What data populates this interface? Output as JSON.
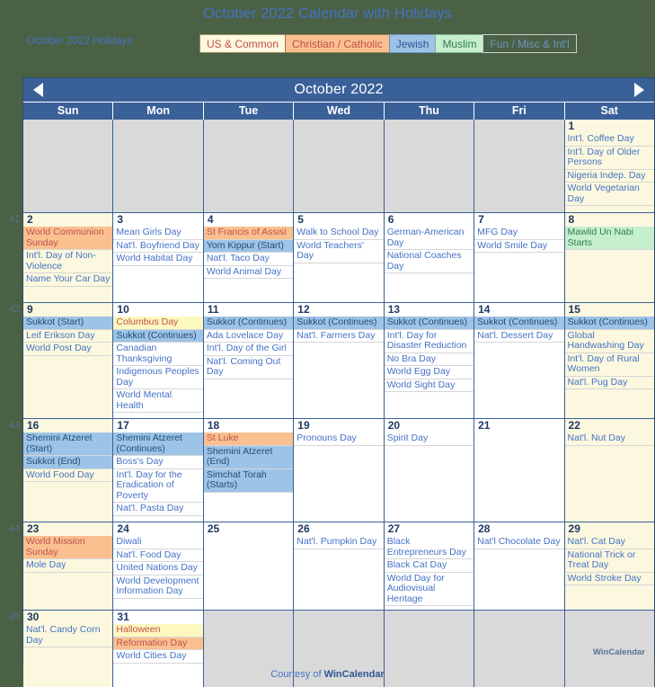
{
  "page": {
    "title": "October 2022 Calendar with Holidays",
    "legend_label": "October 2022 Holidays:",
    "footer_prefix": "Courtesy of ",
    "footer_brand": "WinCalendar",
    "watermark": "WinCalendar",
    "background_color": "#4a6145",
    "accent_color": "#4472c4"
  },
  "legend": [
    {
      "label": "US & Common",
      "key": "us",
      "bg": "#fdf8e0",
      "fg": "#c0504d"
    },
    {
      "label": "Christian / Catholic",
      "key": "chr",
      "bg": "#fac090",
      "fg": "#c0504d"
    },
    {
      "label": "Jewish",
      "key": "jew",
      "bg": "#9dc3e6",
      "fg": "#2f5597"
    },
    {
      "label": "Muslim",
      "key": "mus",
      "bg": "#c6efce",
      "fg": "#2f7d4f"
    },
    {
      "label": "Fun / Misc & Int'l",
      "key": "fun",
      "bg": "#4a6145",
      "fg": "#6f94c6"
    }
  ],
  "calendar": {
    "month_title": "October 2022",
    "prev_label": "◀",
    "next_label": "▶",
    "day_names": [
      "Sun",
      "Mon",
      "Tue",
      "Wed",
      "Thu",
      "Fri",
      "Sat"
    ],
    "weeks": [
      {
        "week_number": "",
        "days": [
          {
            "num": "",
            "blank": true,
            "events": []
          },
          {
            "num": "",
            "blank": true,
            "events": []
          },
          {
            "num": "",
            "blank": true,
            "events": []
          },
          {
            "num": "",
            "blank": true,
            "events": []
          },
          {
            "num": "",
            "blank": true,
            "events": []
          },
          {
            "num": "",
            "blank": true,
            "events": []
          },
          {
            "num": "1",
            "tint": true,
            "events": [
              {
                "text": "Int'l. Coffee Day",
                "type": "us"
              },
              {
                "text": "Int'l. Day of Older Persons",
                "type": "us"
              },
              {
                "text": "Nigeria Indep. Day",
                "type": "us"
              },
              {
                "text": "World Vegetarian Day",
                "type": "us"
              }
            ]
          }
        ]
      },
      {
        "week_number": "41",
        "days": [
          {
            "num": "2",
            "tint": true,
            "events": [
              {
                "text": "World Communion Sunday",
                "type": "chr"
              },
              {
                "text": "Int'l. Day of Non-Violence",
                "type": "us"
              },
              {
                "text": "Name Your Car Day",
                "type": "us"
              }
            ]
          },
          {
            "num": "3",
            "events": [
              {
                "text": "Mean Girls Day",
                "type": "us"
              },
              {
                "text": "Nat'l. Boyfriend Day",
                "type": "us"
              },
              {
                "text": "World Habitat Day",
                "type": "us"
              }
            ]
          },
          {
            "num": "4",
            "events": [
              {
                "text": "St Francis of Assisi",
                "type": "chr"
              },
              {
                "text": "Yom Kippur (Start)",
                "type": "jew"
              },
              {
                "text": "Nat'l. Taco Day",
                "type": "us"
              },
              {
                "text": "World Animal Day",
                "type": "us"
              }
            ]
          },
          {
            "num": "5",
            "events": [
              {
                "text": "Walk to School Day",
                "type": "us"
              },
              {
                "text": "World Teachers' Day",
                "type": "us"
              }
            ]
          },
          {
            "num": "6",
            "events": [
              {
                "text": "German-American Day",
                "type": "us"
              },
              {
                "text": "National Coaches Day",
                "type": "us"
              }
            ]
          },
          {
            "num": "7",
            "events": [
              {
                "text": "MFG Day",
                "type": "us"
              },
              {
                "text": "World Smile Day",
                "type": "us"
              }
            ]
          },
          {
            "num": "8",
            "tint": true,
            "events": [
              {
                "text": "Mawlid Un Nabi Starts",
                "type": "mus"
              }
            ]
          }
        ]
      },
      {
        "week_number": "42",
        "days": [
          {
            "num": "9",
            "tint": true,
            "events": [
              {
                "text": "Sukkot (Start)",
                "type": "jew"
              },
              {
                "text": "Leif Erikson Day",
                "type": "us"
              },
              {
                "text": "World Post Day",
                "type": "us"
              }
            ]
          },
          {
            "num": "10",
            "events": [
              {
                "text": "Columbus Day",
                "type": "com"
              },
              {
                "text": "Sukkot (Continues)",
                "type": "jew"
              },
              {
                "text": "Canadian Thanksgiving",
                "type": "us"
              },
              {
                "text": "Indigenous Peoples Day",
                "type": "us"
              },
              {
                "text": "World Mental Health",
                "type": "us"
              }
            ]
          },
          {
            "num": "11",
            "events": [
              {
                "text": "Sukkot (Continues)",
                "type": "jew"
              },
              {
                "text": "Ada Lovelace Day",
                "type": "us"
              },
              {
                "text": "Int'l. Day of the Girl",
                "type": "us"
              },
              {
                "text": "Nat'l. Coming Out Day",
                "type": "us"
              }
            ]
          },
          {
            "num": "12",
            "events": [
              {
                "text": "Sukkot (Continues)",
                "type": "jew"
              },
              {
                "text": "Nat'l. Farmers Day",
                "type": "us"
              }
            ]
          },
          {
            "num": "13",
            "events": [
              {
                "text": "Sukkot (Continues)",
                "type": "jew"
              },
              {
                "text": "Int'l. Day for Disaster Reduction",
                "type": "us"
              },
              {
                "text": "No Bra Day",
                "type": "us"
              },
              {
                "text": "World Egg Day",
                "type": "us"
              },
              {
                "text": "World Sight Day",
                "type": "us"
              }
            ]
          },
          {
            "num": "14",
            "events": [
              {
                "text": "Sukkot (Continues)",
                "type": "jew"
              },
              {
                "text": "Nat'l. Dessert Day",
                "type": "us"
              }
            ]
          },
          {
            "num": "15",
            "tint": true,
            "events": [
              {
                "text": "Sukkot (Continues)",
                "type": "jew"
              },
              {
                "text": "Global Handwashing Day",
                "type": "us"
              },
              {
                "text": "Int'l. Day of Rural Women",
                "type": "us"
              },
              {
                "text": "Nat'l. Pug Day",
                "type": "us"
              }
            ]
          }
        ]
      },
      {
        "week_number": "43",
        "days": [
          {
            "num": "16",
            "tint": true,
            "events": [
              {
                "text": "Shemini Atzeret (Start)",
                "type": "jew"
              },
              {
                "text": "Sukkot (End)",
                "type": "jew"
              },
              {
                "text": "World Food Day",
                "type": "us"
              }
            ]
          },
          {
            "num": "17",
            "events": [
              {
                "text": "Shemini Atzeret (Continues)",
                "type": "jew"
              },
              {
                "text": "Boss's Day",
                "type": "us"
              },
              {
                "text": "Int'l. Day for the Eradication of Poverty",
                "type": "us"
              },
              {
                "text": "Nat'l. Pasta Day",
                "type": "us"
              }
            ]
          },
          {
            "num": "18",
            "events": [
              {
                "text": "St Luke",
                "type": "chr"
              },
              {
                "text": "Shemini Atzeret (End)",
                "type": "jew"
              },
              {
                "text": "Simchat Torah (Starts)",
                "type": "jew"
              }
            ]
          },
          {
            "num": "19",
            "events": [
              {
                "text": "Pronouns Day",
                "type": "us"
              }
            ]
          },
          {
            "num": "20",
            "events": [
              {
                "text": "Spirit Day",
                "type": "us"
              }
            ]
          },
          {
            "num": "21",
            "events": []
          },
          {
            "num": "22",
            "tint": true,
            "events": [
              {
                "text": "Nat'l. Nut Day",
                "type": "us"
              }
            ]
          }
        ]
      },
      {
        "week_number": "44",
        "days": [
          {
            "num": "23",
            "tint": true,
            "events": [
              {
                "text": "World Mission Sunday",
                "type": "chr"
              },
              {
                "text": "Mole Day",
                "type": "us"
              }
            ]
          },
          {
            "num": "24",
            "events": [
              {
                "text": "Diwali",
                "type": "us"
              },
              {
                "text": "Nat'l. Food Day",
                "type": "us"
              },
              {
                "text": "United Nations Day",
                "type": "us"
              },
              {
                "text": "World Development Information Day",
                "type": "us"
              }
            ]
          },
          {
            "num": "25",
            "events": []
          },
          {
            "num": "26",
            "events": [
              {
                "text": "Nat'l. Pumpkin Day",
                "type": "us"
              }
            ]
          },
          {
            "num": "27",
            "events": [
              {
                "text": "Black Entrepreneurs Day",
                "type": "us"
              },
              {
                "text": "Black Cat Day",
                "type": "us"
              },
              {
                "text": "World Day for Audiovisual Heritage",
                "type": "us"
              }
            ]
          },
          {
            "num": "28",
            "events": [
              {
                "text": "Nat'l Chocolate Day",
                "type": "us"
              }
            ]
          },
          {
            "num": "29",
            "tint": true,
            "events": [
              {
                "text": "Nat'l. Cat Day",
                "type": "us"
              },
              {
                "text": "National Trick or Treat Day",
                "type": "us"
              },
              {
                "text": "World Stroke Day",
                "type": "us"
              }
            ]
          }
        ]
      },
      {
        "week_number": "45",
        "days": [
          {
            "num": "30",
            "tint": true,
            "events": [
              {
                "text": "Nat'l. Candy Corn Day",
                "type": "us"
              }
            ]
          },
          {
            "num": "31",
            "events": [
              {
                "text": "Halloween",
                "type": "com"
              },
              {
                "text": "Reformation Day",
                "type": "chr"
              },
              {
                "text": "World Cities Day",
                "type": "us"
              }
            ]
          },
          {
            "num": "",
            "blank": true,
            "events": []
          },
          {
            "num": "",
            "blank": true,
            "events": []
          },
          {
            "num": "",
            "blank": true,
            "events": []
          },
          {
            "num": "",
            "blank": true,
            "events": []
          },
          {
            "num": "",
            "blank": true,
            "events": []
          }
        ]
      }
    ]
  }
}
